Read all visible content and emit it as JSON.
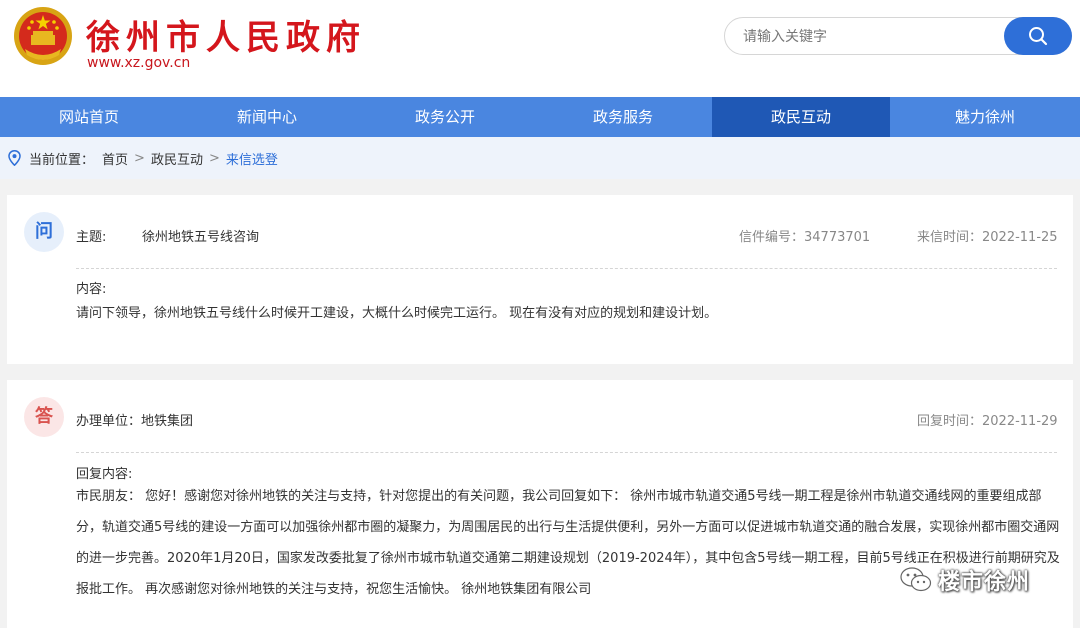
{
  "header": {
    "site_title": "徐州市人民政府",
    "site_url": "www.xz.gov.cn",
    "search_placeholder": "请输入关键字"
  },
  "nav": {
    "items": [
      {
        "label": "网站首页",
        "active": false
      },
      {
        "label": "新闻中心",
        "active": false
      },
      {
        "label": "政务公开",
        "active": false
      },
      {
        "label": "政务服务",
        "active": false
      },
      {
        "label": "政民互动",
        "active": true
      },
      {
        "label": "魅力徐州",
        "active": false
      }
    ]
  },
  "breadcrumb": {
    "prefix": "当前位置：",
    "items": [
      "首页",
      "政民互动",
      "来信选登"
    ],
    "separator": ">"
  },
  "question": {
    "badge": "问",
    "subject_label": "主题:",
    "subject": "徐州地铁五号线咨询",
    "letter_no": "信件编号：34773701",
    "date": "来信时间：2022-11-25",
    "content_label": "内容:",
    "content": "请问下领导，徐州地铁五号线什么时候开工建设，大概什么时候完工运行。 现在有没有对应的规划和建设计划。"
  },
  "answer": {
    "badge": "答",
    "unit": "办理单位：地铁集团",
    "date": "回复时间：2022-11-29",
    "content_label": "回复内容:",
    "content": "市民朋友： 您好！感谢您对徐州地铁的关注与支持，针对您提出的有关问题，我公司回复如下： 徐州市城市轨道交通5号线一期工程是徐州市轨道交通线网的重要组成部分，轨道交通5号线的建设一方面可以加强徐州都市圈的凝聚力，为周围居民的出行与生活提供便利，另外一方面可以促进城市轨道交通的融合发展，实现徐州都市圈交通网的进一步完善。2020年1月20日，国家发改委批复了徐州市城市轨道交通第二期建设规划（2019-2024年），其中包含5号线一期工程，目前5号线正在积极进行前期研究及报批工作。 再次感谢您对徐州地铁的关注与支持，祝您生活愉快。 徐州地铁集团有限公司"
  },
  "watermark": {
    "text": "楼市徐州"
  },
  "colors": {
    "brand_red": "#d4161c",
    "nav_blue": "#4a86e0",
    "nav_active": "#1f58b5",
    "search_blue": "#2e6fd8"
  }
}
